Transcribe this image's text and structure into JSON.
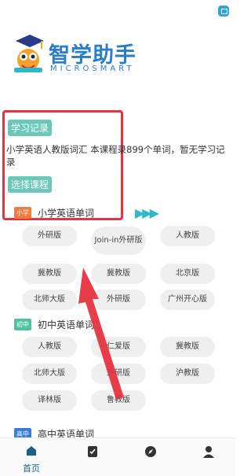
{
  "logo": {
    "title": "智学助手",
    "subtitle": "MICROSMART"
  },
  "study_record": {
    "label": "学习记录"
  },
  "description": "小学英语人教版词汇  本课程录899个单词，暂无学习记录",
  "select_course": {
    "label": "选择课程"
  },
  "sections": [
    {
      "tag": "小学",
      "title": "小学英语单词",
      "tag_color": "#f07b3f",
      "items": [
        "外研版",
        "Join-in外研版",
        "人教版",
        "冀教版",
        "冀教版",
        "北京版",
        "北师大版",
        "外研版",
        "广州开心版"
      ]
    },
    {
      "tag": "初中",
      "title": "初中英语单词",
      "tag_color": "#4fc3a1",
      "items": [
        "人教版",
        "仁爱版",
        "冀教版",
        "北师大版",
        "外研版",
        "沪教版",
        "译林版",
        "鲁教版"
      ]
    },
    {
      "tag": "高中",
      "title": "高中英语单词",
      "tag_color": "#3a7bd5"
    }
  ],
  "nav": {
    "home_label": "首页"
  },
  "colors": {
    "accent": "#6cc8b8",
    "highlight_box": "#e8323f",
    "arrow": "#e8323f",
    "brand": "#2a7ec7"
  },
  "icons": [
    "app-menu-icon",
    "home-icon",
    "book-icon",
    "compass-icon",
    "user-icon"
  ]
}
